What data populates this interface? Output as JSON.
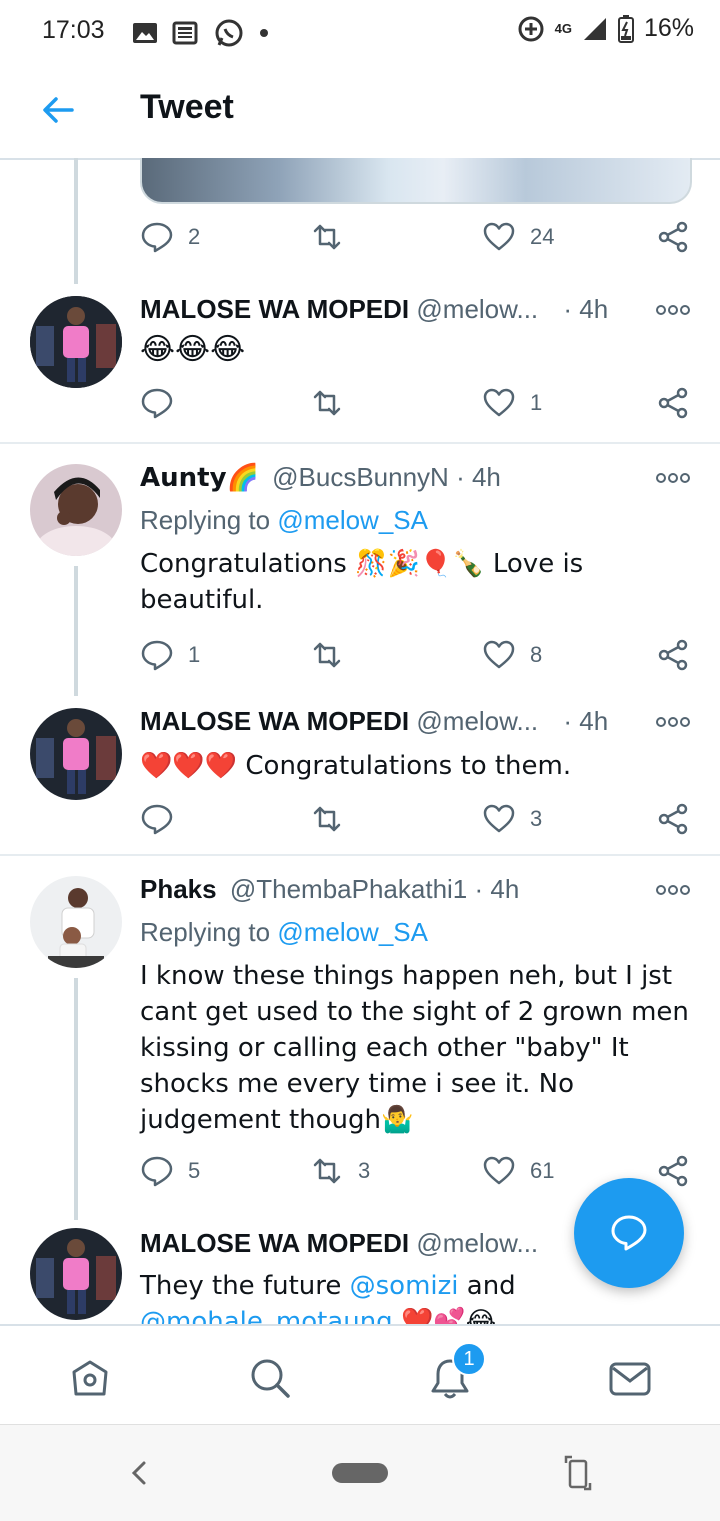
{
  "status_bar": {
    "time": "17:03",
    "network": "4G",
    "battery": "16%",
    "icons_left": [
      "image-icon",
      "news-icon",
      "whatsapp-icon",
      "dot-icon"
    ]
  },
  "header": {
    "title": "Tweet"
  },
  "top_tweet_actions": {
    "replies": "2",
    "retweets": "",
    "likes": "24"
  },
  "tweets": [
    {
      "name": "MALOSE WA MOPEDI",
      "handle": "@melow...",
      "time": "· 4h",
      "replying_prefix": "",
      "replying_handle": "",
      "text": "😂😂😂",
      "replies": "",
      "retweets": "",
      "likes": "1"
    },
    {
      "name": "Aunty🌈",
      "handle": "@BucsBunnyN",
      "time": "· 4h",
      "replying_prefix": "Replying to ",
      "replying_handle": "@melow_SA",
      "text": "Congratulations 🎊🎉🎈🍾 Love is beautiful.",
      "replies": "1",
      "retweets": "",
      "likes": "8"
    },
    {
      "name": "MALOSE WA MOPEDI",
      "handle": "@melow...",
      "time": "· 4h",
      "replying_prefix": "",
      "replying_handle": "",
      "text": "❤️❤️❤️ Congratulations to them.",
      "replies": "",
      "retweets": "",
      "likes": "3"
    },
    {
      "name": "Phaks",
      "handle": "@ThembaPhakathi1",
      "time": "· 4h",
      "replying_prefix": "Replying to ",
      "replying_handle": "@melow_SA",
      "text": "I know these things happen neh, but I jst cant get used to the sight of 2 grown men kissing or calling each other \"baby\" It shocks me every time i see it. No judgement though🤷‍♂️",
      "replies": "5",
      "retweets": "3",
      "likes": "61"
    },
    {
      "name": "MALOSE WA MOPEDI",
      "handle": "@melow...",
      "time": "",
      "text_start": "They the future ",
      "mention1": "@somizi",
      "text_mid": " and",
      "mention2": "@mohale_motaung",
      "text_end": " ❤️💕😂"
    }
  ],
  "tabbar": {
    "notifications_badge": "1",
    "items": [
      "home-icon",
      "search-icon",
      "notifications-icon",
      "messages-icon"
    ]
  },
  "colors": {
    "accent": "#1d9bf0",
    "text": "#0f1419",
    "muted": "#536471",
    "divider": "#e6ecf0"
  }
}
